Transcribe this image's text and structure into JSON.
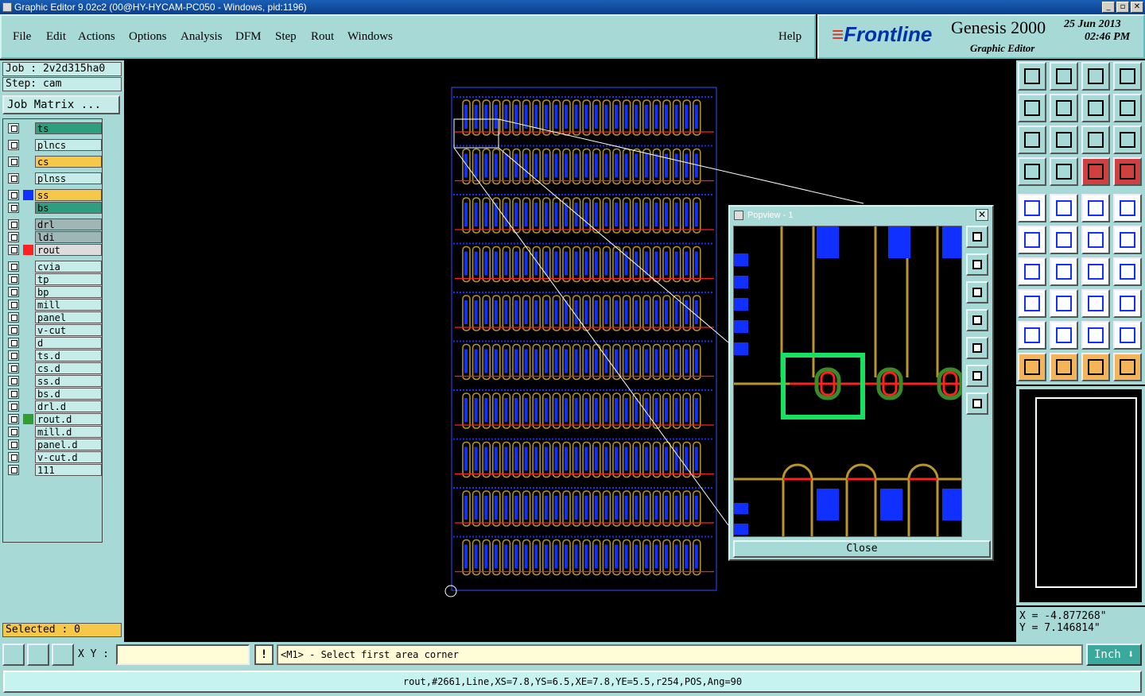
{
  "window": {
    "title": "Graphic Editor 9.02c2 (00@HY-HYCAM-PC050 - Windows, pid:1196)"
  },
  "menu": {
    "items": [
      "File",
      "Edit",
      "Actions",
      "Options",
      "Analysis",
      "DFM",
      "Step",
      "Rout",
      "Windows"
    ],
    "help": "Help"
  },
  "brand": {
    "logo": "Frontline",
    "product": "Genesis 2000",
    "subtitle": "Graphic Editor",
    "date": "25 Jun 2013",
    "time": "02:46 PM"
  },
  "job": {
    "job_label": "Job : 2v2d315ha0",
    "step_label": "Step: cam",
    "matrix_button": "Job Matrix ..."
  },
  "layers": [
    {
      "name": "ts",
      "bg": "#2e9e7e",
      "swatch": ""
    },
    {
      "name": "plncs",
      "bg": "#c6ece9",
      "swatch": ""
    },
    {
      "name": "cs",
      "bg": "#f6c84a",
      "swatch": ""
    },
    {
      "name": "plnss",
      "bg": "#c6ece9",
      "swatch": ""
    },
    {
      "name": "ss",
      "bg": "#f6c84a",
      "swatch": "#1030ff"
    },
    {
      "name": "bs",
      "bg": "#2e9e7e",
      "swatch": ""
    },
    {
      "name": "drl",
      "bg": "#9fb6b6",
      "swatch": ""
    },
    {
      "name": "ldi",
      "bg": "#9fb6b6",
      "swatch": ""
    },
    {
      "name": "rout",
      "bg": "#dcdcdc",
      "swatch": "#ff2020"
    },
    {
      "name": "cvia",
      "bg": "#c6ece9",
      "swatch": ""
    },
    {
      "name": "tp",
      "bg": "#c6ece9",
      "swatch": ""
    },
    {
      "name": "bp",
      "bg": "#c6ece9",
      "swatch": ""
    },
    {
      "name": "mill",
      "bg": "#c6ece9",
      "swatch": ""
    },
    {
      "name": "panel",
      "bg": "#c6ece9",
      "swatch": ""
    },
    {
      "name": "v-cut",
      "bg": "#c6ece9",
      "swatch": ""
    },
    {
      "name": "d",
      "bg": "#c6ece9",
      "swatch": ""
    },
    {
      "name": "ts.d",
      "bg": "#c6ece9",
      "swatch": ""
    },
    {
      "name": "cs.d",
      "bg": "#c6ece9",
      "swatch": ""
    },
    {
      "name": "ss.d",
      "bg": "#c6ece9",
      "swatch": ""
    },
    {
      "name": "bs.d",
      "bg": "#c6ece9",
      "swatch": ""
    },
    {
      "name": "drl.d",
      "bg": "#c6ece9",
      "swatch": ""
    },
    {
      "name": "rout.d",
      "bg": "#c6ece9",
      "swatch": "#2e9e2e"
    },
    {
      "name": "mill.d",
      "bg": "#c6ece9",
      "swatch": ""
    },
    {
      "name": "panel.d",
      "bg": "#c6ece9",
      "swatch": ""
    },
    {
      "name": "v-cut.d",
      "bg": "#c6ece9",
      "swatch": ""
    },
    {
      "name": "111",
      "bg": "#c6ece9",
      "swatch": ""
    }
  ],
  "selected": "Selected : 0",
  "popview": {
    "title": "Popview - 1",
    "close_button": "Close"
  },
  "coords": {
    "x": "X = -4.877268\"",
    "y": "Y = 7.146814\""
  },
  "command": {
    "xy_label": "X Y :",
    "xy_value": "",
    "bang": "!",
    "prompt": "<M1> - Select first area corner",
    "unit": "Inch"
  },
  "status": "rout,#2661,Line,XS=7.8,YS=6.5,XE=7.8,YE=5.5,r254,POS,Ang=90",
  "colors": {
    "panel": "#a7dad7",
    "trace": "#b8962a",
    "pad": "#1030ff",
    "rout": "#ff2020",
    "highlight": "#18e060"
  }
}
